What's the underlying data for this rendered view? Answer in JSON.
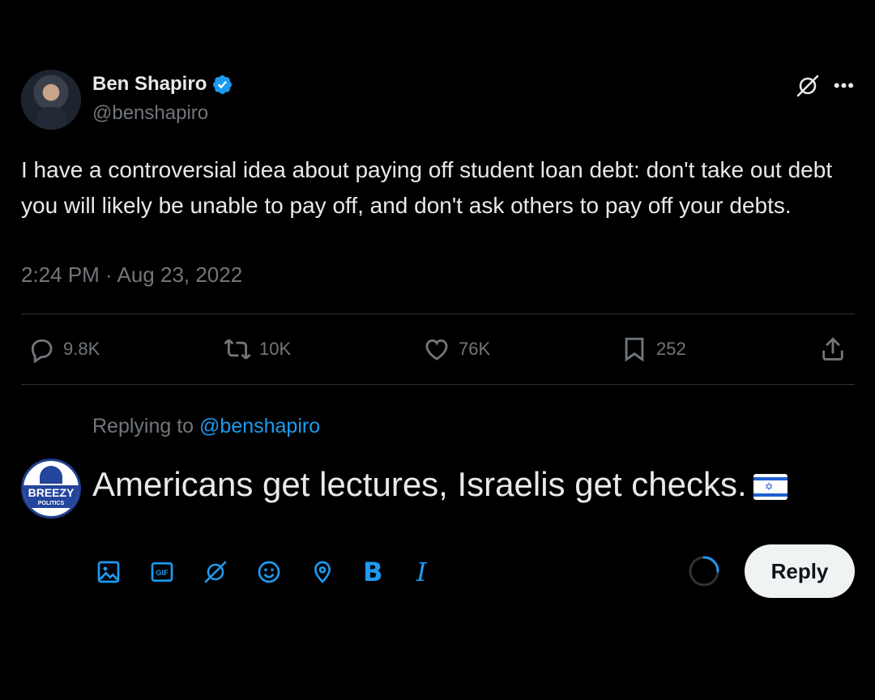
{
  "tweet": {
    "display_name": "Ben Shapiro",
    "handle": "@benshapiro",
    "text": "I have a controversial idea about paying off student loan debt: don't take out debt you will likely be unable to pay off, and don't ask others to pay off your debts.",
    "timestamp": "2:24 PM · Aug 23, 2022",
    "stats": {
      "replies": "9.8K",
      "reposts": "10K",
      "likes": "76K",
      "bookmarks": "252"
    }
  },
  "reply": {
    "replying_label": "Replying to ",
    "replying_handle": "@benshapiro",
    "avatar_text": "BREEZY",
    "avatar_subtext": "POLITICS",
    "draft_text": "Americans get lectures, Israelis get checks.",
    "button_label": "Reply",
    "progress": 0.25
  },
  "toolbar": {
    "bold_label": "B",
    "italic_label": "I",
    "gif_label": "GIF"
  },
  "colors": {
    "accent": "#1d9bf0",
    "muted": "#71767b",
    "background": "#000000"
  }
}
